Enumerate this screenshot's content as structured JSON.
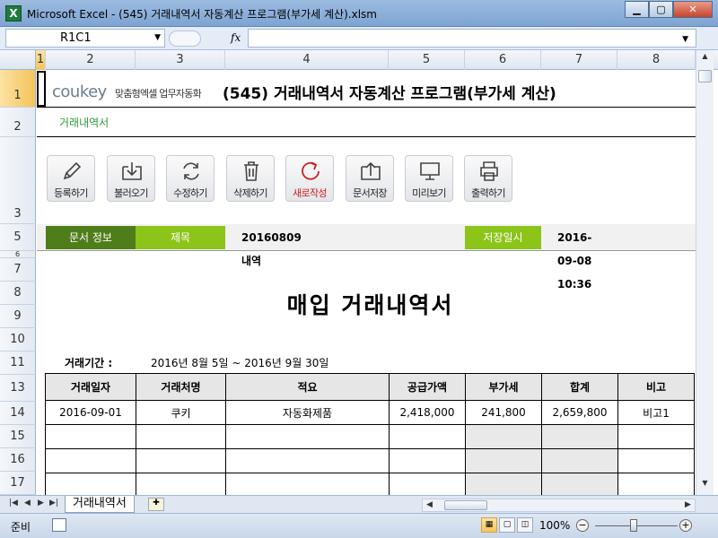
{
  "window": {
    "title": "Microsoft Excel - (545) 거래내역서 자동계산 프로그램(부가세 계산).xlsm",
    "app_icon_letter": "X",
    "minimize": "▁",
    "maximize": "▢",
    "close": "✕"
  },
  "formula_bar": {
    "name_box": "R1C1",
    "fx": "fx",
    "formula": ""
  },
  "columns": [
    "1",
    "2",
    "3",
    "4",
    "5",
    "6",
    "7",
    "8"
  ],
  "rows": [
    "1",
    "2",
    "3",
    "5",
    "6",
    "7",
    "8",
    "9",
    "10",
    "11",
    "13",
    "14",
    "15",
    "16",
    "17"
  ],
  "header": {
    "logo": "coukey",
    "logo_sub": "맞춤형엑셀 업무자동화",
    "title": "(545) 거래내역서 자동계산 프로그램(부가세 계산)",
    "subtitle": "거래내역서"
  },
  "toolbar": {
    "register": "등록하기",
    "load": "불러오기",
    "edit": "수정하기",
    "delete": "삭제하기",
    "new": "새로작성",
    "save_doc": "문서저장",
    "preview": "미리보기",
    "print": "출력하기"
  },
  "info": {
    "doc_info_label": "문서 정보",
    "subject_label": "제목",
    "subject_value": "20160809 내역",
    "saved_label": "저장일시",
    "saved_value": "2016-09-08 10:36"
  },
  "document": {
    "title": "매입 거래내역서",
    "period_label": "거래기간 :",
    "period_value": "2016년 8월 5일 ~ 2016년 9월 30일"
  },
  "table": {
    "headers": {
      "date": "거래일자",
      "vendor": "거래처명",
      "desc": "적요",
      "supply": "공급가액",
      "vat": "부가세",
      "total": "합계",
      "note": "비고"
    },
    "rows": [
      {
        "date": "2016-09-01",
        "vendor": "쿠키",
        "desc": "자동화제품",
        "supply": "2,418,000",
        "vat": "241,800",
        "total": "2,659,800",
        "note": "비고1"
      }
    ]
  },
  "sheet_tabs": {
    "active": "거래내역서"
  },
  "status": {
    "ready": "준비",
    "zoom": "100%",
    "zoom_out": "−",
    "zoom_in": "+"
  },
  "colors": {
    "dark_green": "#4e7d1a",
    "light_green": "#8cc41a",
    "accent_green": "#2e9a3b",
    "red": "#c82020"
  }
}
